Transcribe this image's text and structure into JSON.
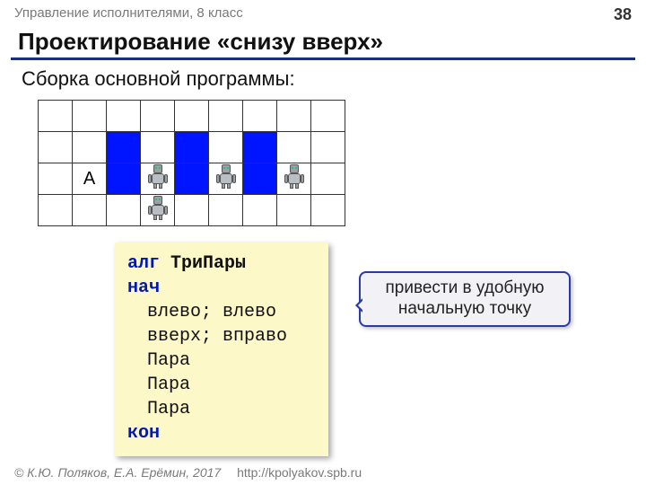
{
  "header": {
    "topic": "Управление исполнителями, 8 класс",
    "page": "38"
  },
  "title": "Проектирование «снизу вверх»",
  "subtitle": "Сборка основной программы:",
  "grid": {
    "label_A": "А"
  },
  "code": {
    "kw_alg": "алг",
    "alg_name": "ТриПары",
    "kw_begin": "нач",
    "line1": "влево; влево",
    "line2": "вверх; вправо",
    "line3": "Пара",
    "line4": "Пара",
    "line5": "Пара",
    "kw_end": "кон"
  },
  "callout": {
    "line1": "привести в удобную",
    "line2": "начальную точку"
  },
  "footer": {
    "copyright": "© К.Ю. Поляков, Е.А. Ерёмин, 2017",
    "url": "http://kpolyakov.spb.ru"
  }
}
